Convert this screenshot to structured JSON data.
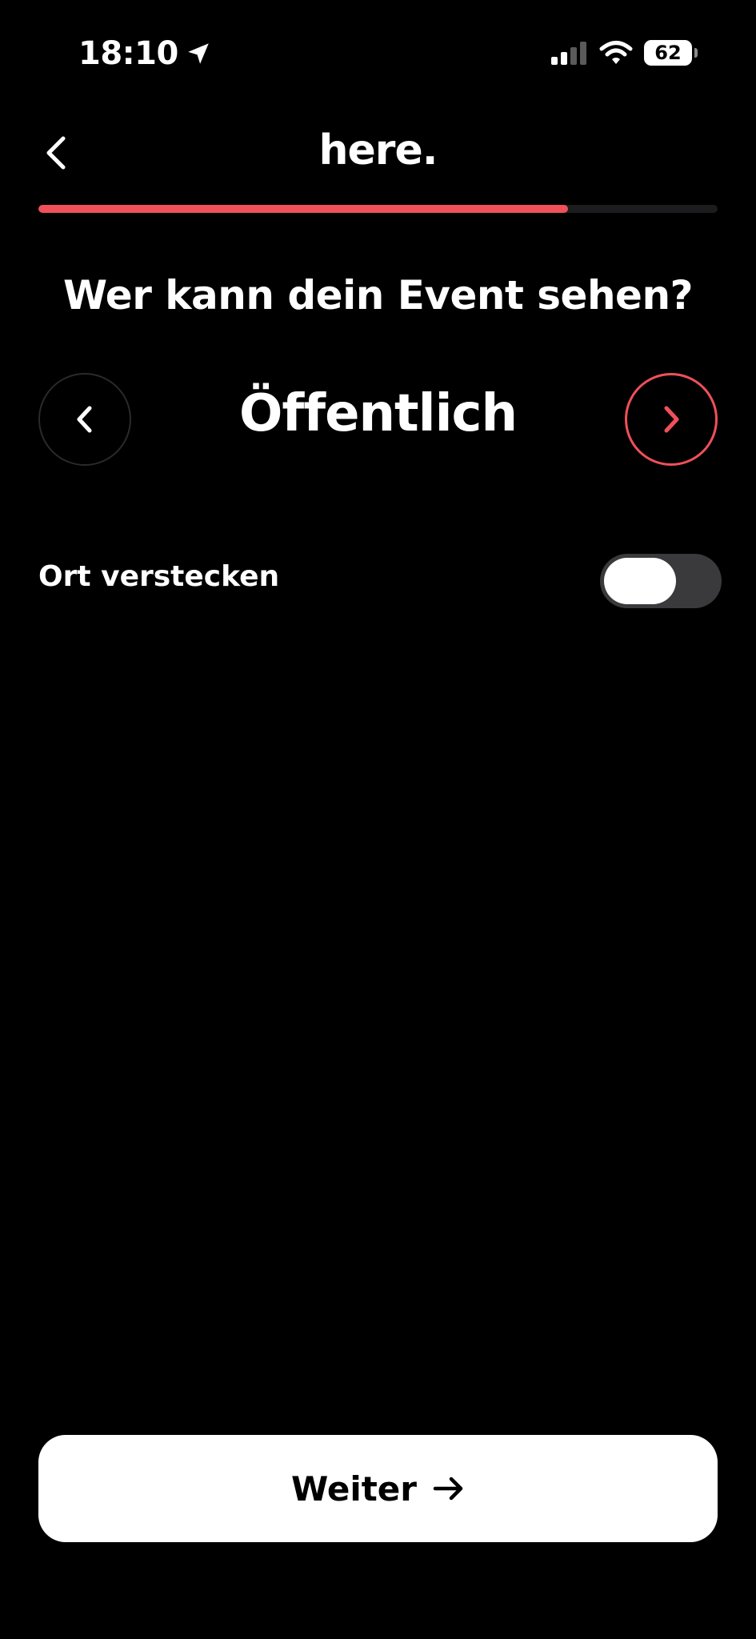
{
  "status_bar": {
    "time": "18:10",
    "battery": "62",
    "icons": [
      "location-arrow-icon",
      "signal-icon",
      "wifi-icon",
      "battery-icon"
    ]
  },
  "header": {
    "brand": "here.",
    "progress_fraction": 0.78
  },
  "question": "Wer kann dein Event sehen?",
  "visibility": {
    "value": "Öffentlich"
  },
  "hide_location": {
    "label": "Ort verstecken",
    "enabled": false
  },
  "next_button": {
    "label": "Weiter"
  },
  "colors": {
    "accent": "#f0505a",
    "background": "#000000",
    "button_bg": "#ffffff"
  }
}
